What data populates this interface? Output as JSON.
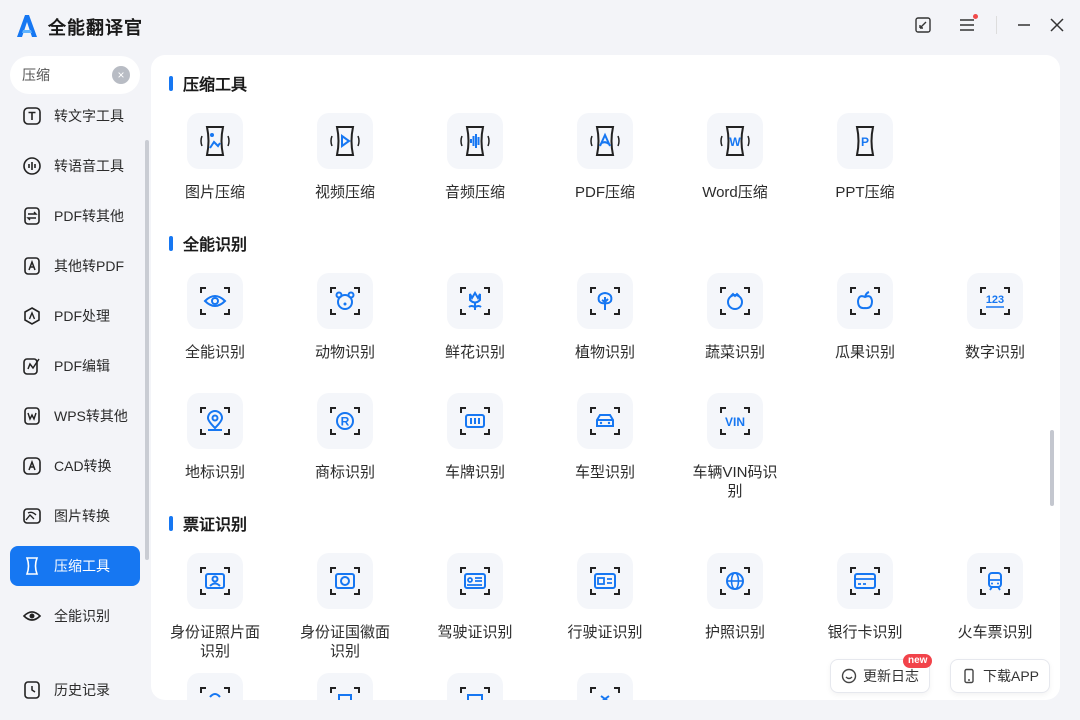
{
  "app": {
    "title": "全能翻译官"
  },
  "search": {
    "value": "压缩",
    "clear_icon": "×"
  },
  "sidebar": {
    "items": [
      {
        "label": "转文字工具",
        "icon": "text-icon"
      },
      {
        "label": "转语音工具",
        "icon": "audio-wave-icon"
      },
      {
        "label": "PDF转其他",
        "icon": "pdf-convert-icon"
      },
      {
        "label": "其他转PDF",
        "icon": "to-pdf-icon"
      },
      {
        "label": "PDF处理",
        "icon": "pdf-process-icon"
      },
      {
        "label": "PDF编辑",
        "icon": "pdf-edit-icon"
      },
      {
        "label": "WPS转其他",
        "icon": "wps-icon"
      },
      {
        "label": "CAD转换",
        "icon": "cad-icon"
      },
      {
        "label": "图片转换",
        "icon": "image-icon"
      },
      {
        "label": "压缩工具",
        "icon": "compress-icon",
        "active": true
      },
      {
        "label": "全能识别",
        "icon": "eye-scan-icon"
      }
    ],
    "history": "历史记录"
  },
  "sections": [
    {
      "title": "压缩工具"
    },
    {
      "title": "全能识别"
    },
    {
      "title": "票证识别"
    }
  ],
  "tools": {
    "compress": [
      "图片压缩",
      "视频压缩",
      "音频压缩",
      "PDF压缩",
      "Word压缩",
      "PPT压缩"
    ],
    "recognize_row1": [
      "全能识别",
      "动物识别",
      "鲜花识别",
      "植物识别",
      "蔬菜识别",
      "瓜果识别",
      "数字识别"
    ],
    "recognize_row2": [
      "地标识别",
      "商标识别",
      "车牌识别",
      "车型识别",
      "车辆VIN码识别"
    ],
    "cert": [
      "身份证照片面识别",
      "身份证国徽面识别",
      "驾驶证识别",
      "行驶证识别",
      "护照识别",
      "银行卡识别",
      "火车票识别"
    ]
  },
  "icon_text": {
    "word": "W",
    "ppt": "P",
    "digits": "123",
    "vin": "VIN",
    "trademark": "R"
  },
  "footer": {
    "changelog": "更新日志",
    "new_badge": "new",
    "download": "下载APP"
  },
  "colors": {
    "accent": "#1677f2",
    "badge": "#f2434a"
  }
}
